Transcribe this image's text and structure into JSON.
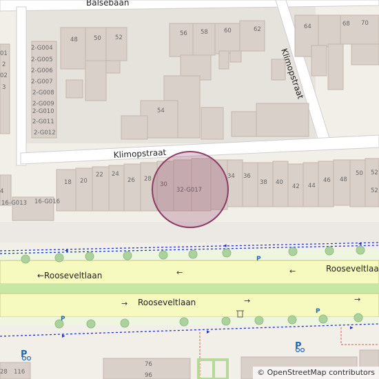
{
  "map": {
    "streets": {
      "balsebaan": "Balsebaan",
      "klimopstraat_horizontal": "Klimopstraat",
      "klimopstraat_diagonal": "Klimopstraat",
      "rooseveltlaan_west": "←Rooseveltlaan",
      "rooseveltlaan_east": "Rooseveltlaan",
      "rooseveltlaan_south": "Rooseveltlaan"
    },
    "house_numbers": {
      "n48": "48",
      "n50": "50",
      "n52": "52",
      "n56": "56",
      "n58": "58",
      "n60": "60",
      "n62": "62",
      "n64": "64",
      "n68": "68",
      "n70": "70",
      "n54": "54",
      "g004": "2-G004",
      "g005": "2-G005",
      "g006": "2-G006",
      "g007": "2-G007",
      "g008": "2-G008",
      "g009": "2-G009",
      "g010": "2-G010",
      "g011": "2-G011",
      "g012": "2-G012",
      "e01": "01",
      "e2": "2",
      "e02": "02",
      "e3": "3",
      "e4": "4",
      "n18": "18",
      "n20": "20",
      "n22": "22",
      "n24": "24",
      "n26": "26",
      "n28": "28",
      "n30": "30",
      "n32g017": "32-G017",
      "n34": "34",
      "n36": "36",
      "n38": "38",
      "n40": "40",
      "n42": "42",
      "n44": "44",
      "n46": "46",
      "n48b": "48",
      "n50b": "50",
      "n52b": "52",
      "n52c": "52",
      "g013": "16-G013",
      "g016": "16-G016",
      "s76": "76",
      "s96": "96",
      "s116": "116",
      "s28": "28"
    },
    "parking": {
      "p1": "P",
      "p2": "P",
      "p3": "P",
      "p4": "P",
      "p5": "P"
    },
    "highlight": {
      "address": "32-G017",
      "color": "#8b3a62"
    },
    "colors": {
      "background": "#f2efe9",
      "building": "#d9d0c9",
      "building_stroke": "#c4b6ab",
      "road": "#ffffff",
      "primary_road": "#f7fabf",
      "median": "#c8e6a4",
      "cycleway": "#1d34c0",
      "footway": "#e07a66",
      "tree": "#add19e"
    },
    "icons": {
      "parking_icon": "parking-icon",
      "bicycle_icon": "bicycle-parking-icon",
      "waste_icon": "waste-basket-icon"
    }
  },
  "attribution": {
    "symbol": "©",
    "text": "OpenStreetMap contributors"
  }
}
